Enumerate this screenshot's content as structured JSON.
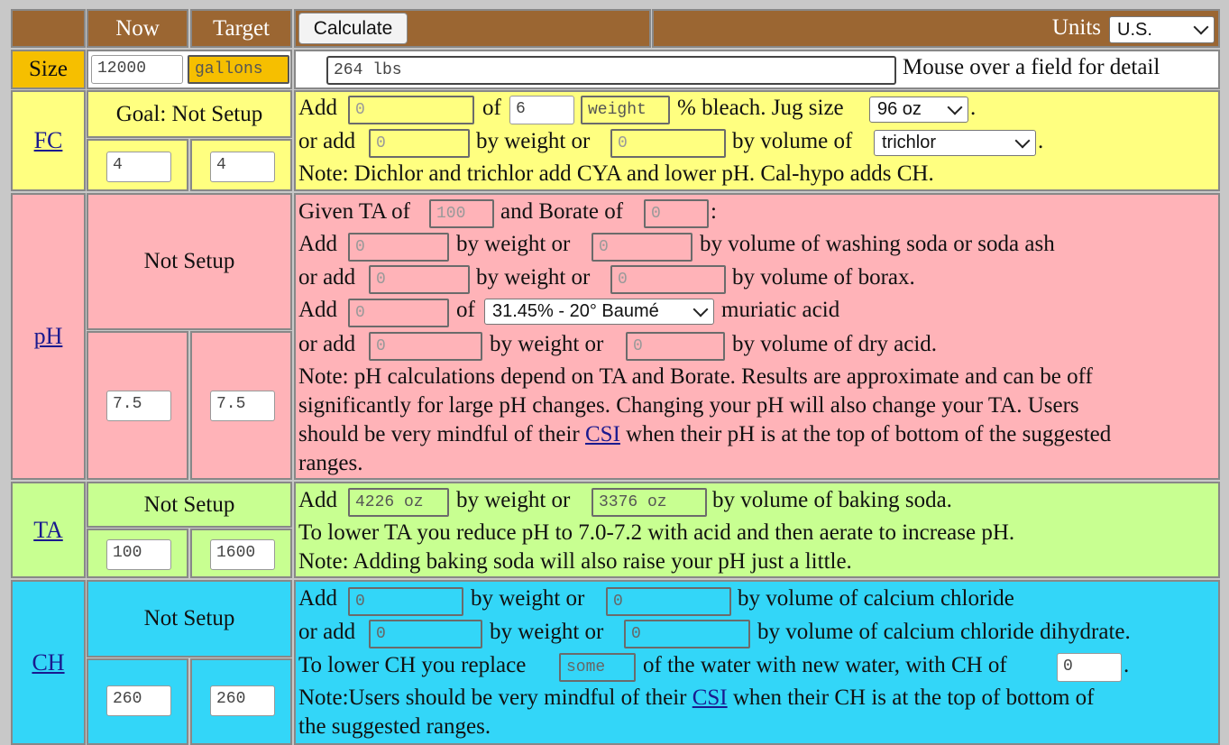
{
  "header": {
    "now": "Now",
    "target": "Target",
    "calculate": "Calculate",
    "units_label": "Units",
    "units_value": "U.S."
  },
  "size": {
    "label": "Size",
    "volume": "12000",
    "unit": "gallons",
    "weight": "264 lbs",
    "hint": "Mouse over a field for detail"
  },
  "fc": {
    "label": "FC",
    "goal": "Goal: Not Setup",
    "now": "4",
    "target": "4",
    "t_add": "Add",
    "add_amount": "0",
    "t_of": "of",
    "bleach_pct": "6",
    "bleach_mode": "weight",
    "t_bleach": "% bleach. Jug size",
    "jug_size": "96 oz",
    "t_dot": ".",
    "t_oradd": "or add",
    "add_weight": "0",
    "t_byweight": "by weight or",
    "add_volume": "0",
    "t_byvolumeof": "by volume of",
    "chem": "trichlor",
    "t_dot2": ".",
    "note": "Note: Dichlor and trichlor add CYA and lower pH. Cal-hypo adds CH."
  },
  "ph": {
    "label": "pH",
    "goal": "Not Setup",
    "now": "7.5",
    "target": "7.5",
    "t_givenTA": "Given TA of",
    "ta": "100",
    "t_borate": "and Borate of",
    "borate": "0",
    "t_colon": ":",
    "t_add1": "Add",
    "soda_weight": "0",
    "t_bw1": "by weight or",
    "soda_volume": "0",
    "t_soda": "by volume of washing soda or soda ash",
    "t_oradd2": "or add",
    "borax_weight": "0",
    "t_bw2": "by weight or",
    "borax_volume": "0",
    "t_borax": "by volume of borax.",
    "t_add3": "Add",
    "acid_amount": "0",
    "t_of3": "of",
    "acid_type": "31.45% - 20° Baumé",
    "t_muriatic": "muriatic acid",
    "t_oradd4": "or add",
    "dry_weight": "0",
    "t_bw4": "by weight or",
    "dry_volume": "0",
    "t_dry": "by volume of dry acid.",
    "note_line1": "Note: pH calculations depend on TA and Borate. Results are approximate and can be off",
    "note_line2": "significantly for large pH changes. Changing your pH will also change your TA. Users",
    "note_line3a": "should be very mindful of their",
    "note_csi": "CSI",
    "note_line3b": "when their pH is at the top of bottom of the suggested",
    "note_line4": "ranges."
  },
  "ta": {
    "label": "TA",
    "goal": "Not Setup",
    "now": "100",
    "target": "1600",
    "t_add": "Add",
    "weight": "4226 oz",
    "t_bw": "by weight or",
    "volume": "3376 oz",
    "t_bv": "by volume of baking soda.",
    "line2": "To lower TA you reduce pH to 7.0-7.2 with acid and then aerate to increase pH.",
    "line3": "Note: Adding baking soda will also raise your pH just a little."
  },
  "ch": {
    "label": "CH",
    "goal": "Not Setup",
    "now": "260",
    "target": "260",
    "t_add": "Add",
    "cc_weight": "0",
    "t_bw1": "by weight or",
    "cc_volume": "0",
    "t_cc": "by volume of calcium chloride",
    "t_oradd": "or add",
    "ccd_weight": "0",
    "t_bw2": "by weight or",
    "ccd_volume": "0",
    "t_ccd": "by volume of calcium chloride dihydrate.",
    "t_lower": "To lower CH you replace",
    "replace": "some",
    "t_water": "of the water with new water, with CH of",
    "new_ch": "0",
    "t_dot": ".",
    "note_a": "Note:Users should be very mindful of their",
    "note_csi": "CSI",
    "note_b": "when their CH is at the top of bottom of",
    "note_c": "the suggested ranges."
  },
  "colors": {
    "brown": "#9b6632",
    "gold": "#f6bf00",
    "yellow": "#ffff80",
    "pink": "#ffb3b8",
    "green": "#c8ff91",
    "cyan": "#33d6f8"
  }
}
